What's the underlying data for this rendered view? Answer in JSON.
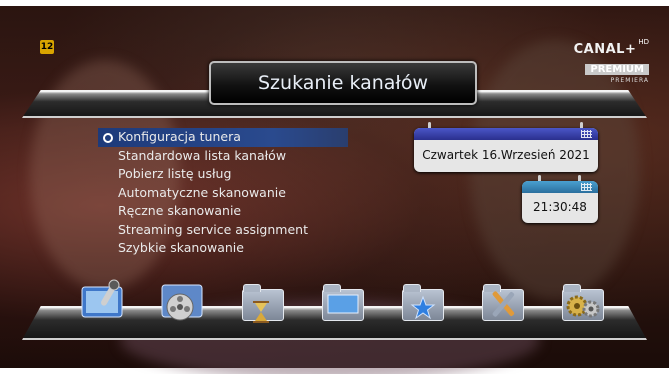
{
  "header": {
    "title": "Szukanie kanałów"
  },
  "overlay": {
    "age_rating": "12",
    "channel_logo": {
      "brand": "CANAL+",
      "hd": "HD",
      "premium": "PREMIUM",
      "sub": "PREMIERA"
    }
  },
  "menu": {
    "selected_index": 0,
    "items": [
      "Konfiguracja tunera",
      "Standardowa lista kanałów",
      "Pobierz listę usług",
      "Automatyczne skanowanie",
      "Ręczne skanowanie",
      "Streaming service assignment",
      "Szybkie skanowanie"
    ]
  },
  "calendar": {
    "date": "Czwartek  16.Wrzesień 2021",
    "time": "21:30:48"
  },
  "toolbar": {
    "icons": [
      "media-player-icon",
      "video-reel-icon",
      "timer-folder-icon",
      "folder-icon",
      "favorites-folder-icon",
      "tools-folder-icon",
      "settings-gears-icon"
    ]
  },
  "colors": {
    "selection": "#2a4a8e",
    "calendar_header": "#2a2f8e",
    "time_header": "#2a6f9e"
  }
}
